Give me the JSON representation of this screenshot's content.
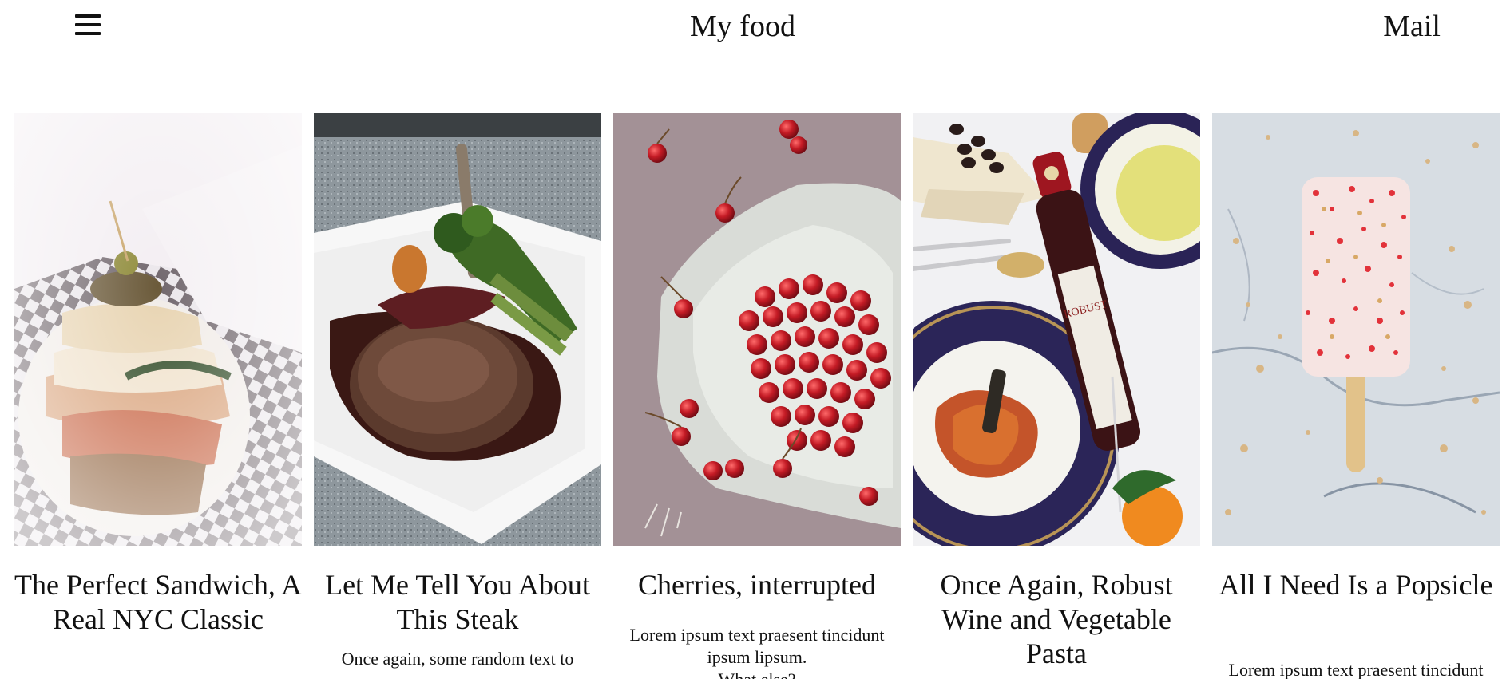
{
  "header": {
    "menu_icon": "hamburger-menu-icon",
    "title": "My food",
    "mail_label": "Mail"
  },
  "cards": [
    {
      "title": "The Perfect Sandwich, A Real NYC Classic",
      "image_subject": "sandwich",
      "text": []
    },
    {
      "title": "Let Me Tell You About This Steak",
      "image_subject": "steak",
      "text": [
        "Once again, some random text to"
      ]
    },
    {
      "title": "Cherries, interrupted",
      "image_subject": "cherries",
      "text": [
        "Lorem ipsum text praesent tincidunt ipsum lipsum.",
        "What else?"
      ]
    },
    {
      "title": "Once Again, Robust Wine and Vegetable Pasta",
      "image_subject": "wine-pasta",
      "wine_label": "ROBUST",
      "text": []
    },
    {
      "title": "All I Need Is a Popsicle",
      "image_subject": "popsicle",
      "text": [
        "Lorem ipsum text praesent tincidunt"
      ]
    }
  ]
}
